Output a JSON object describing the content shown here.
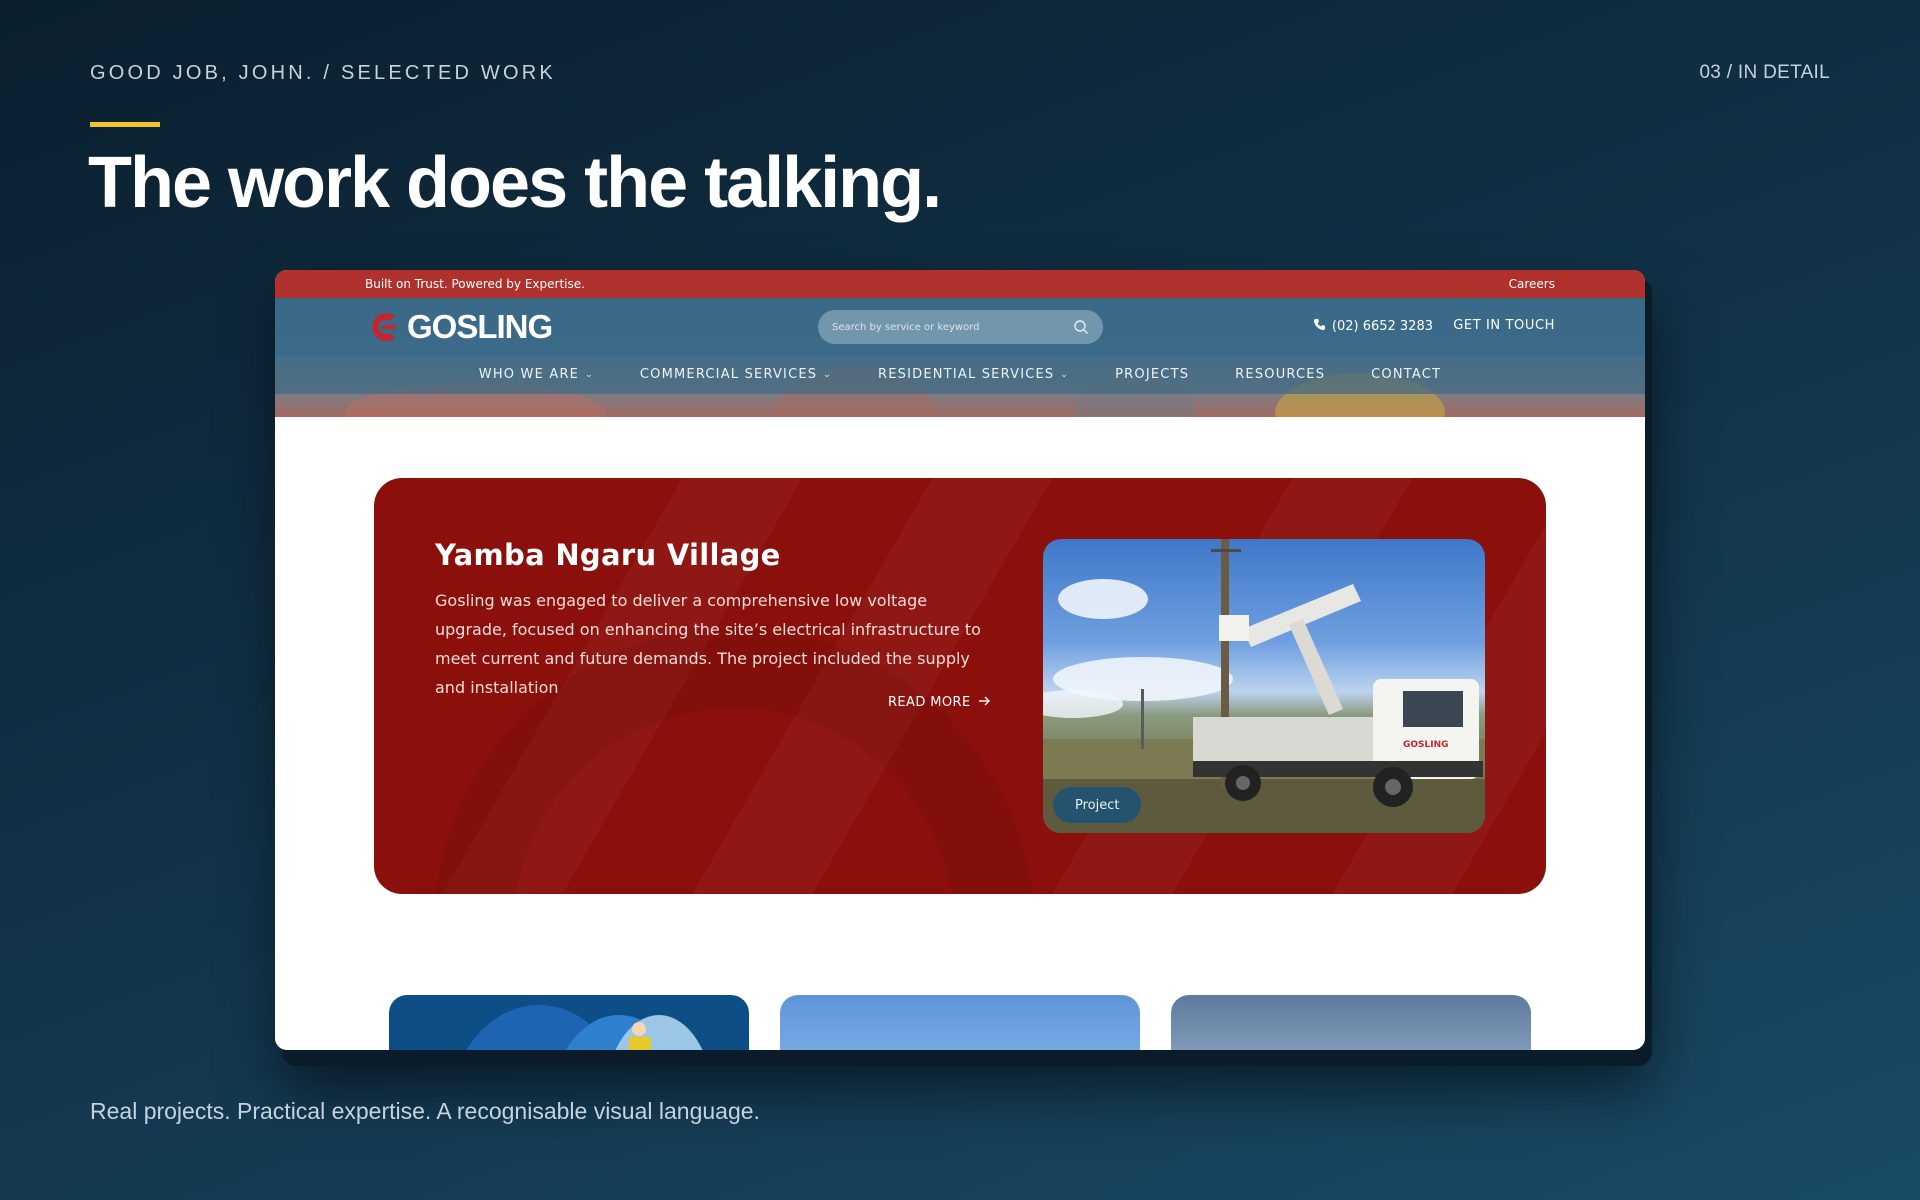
{
  "slide": {
    "eyebrow": "GOOD JOB, JOHN. / SELECTED WORK",
    "page_indicator": "03 / IN DETAIL",
    "title": "The work does the talking.",
    "caption": "Real projects. Practical expertise. A recognisable visual language.",
    "accent_color": "#f2c230"
  },
  "site": {
    "topbar": {
      "tagline": "Built on Trust. Powered by Expertise.",
      "careers": "Careers"
    },
    "logo_text": "GOSLING",
    "search": {
      "placeholder": "Search by service or keyword"
    },
    "phone": "(02) 6652 3283",
    "cta": "GET IN TOUCH",
    "nav": [
      {
        "label": "WHO WE ARE",
        "has_dropdown": true
      },
      {
        "label": "COMMERCIAL SERVICES",
        "has_dropdown": true
      },
      {
        "label": "RESIDENTIAL SERVICES",
        "has_dropdown": true
      },
      {
        "label": "PROJECTS",
        "has_dropdown": false
      },
      {
        "label": "RESOURCES",
        "has_dropdown": false
      },
      {
        "label": "CONTACT",
        "has_dropdown": false
      }
    ],
    "brand_red": "#b0302b",
    "feature": {
      "title": "Yamba Ngaru Village",
      "body": "Gosling was engaged to deliver a comprehensive low voltage upgrade, focused on enhancing the site’s electrical infrastructure to meet current and future demands. The project included the supply and installation",
      "read_more": "READ MORE",
      "badge": "Project",
      "truck_logo": "GOSLING"
    }
  }
}
